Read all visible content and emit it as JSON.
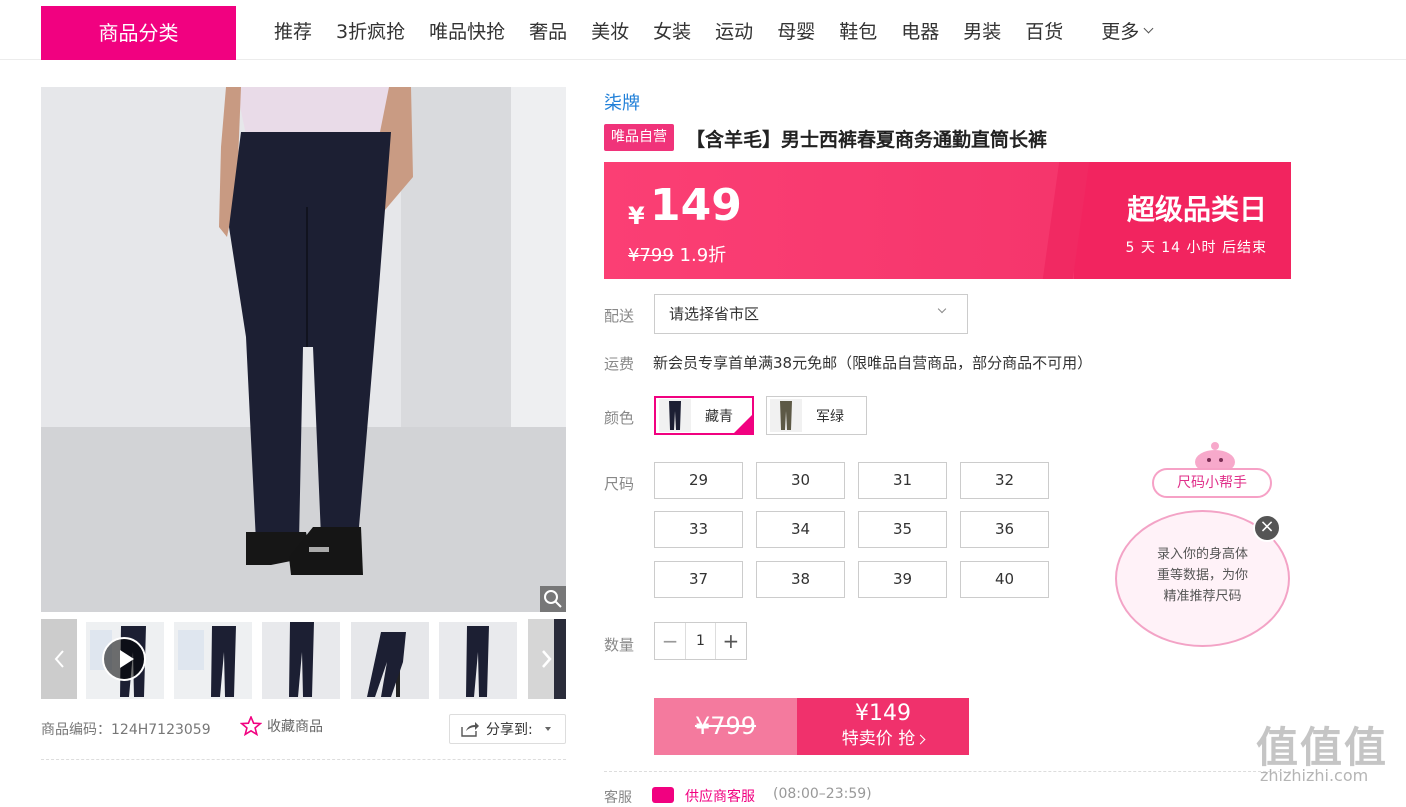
{
  "nav": {
    "category_button": "商品分类",
    "items": [
      "推荐",
      "3折疯抢",
      "唯品快抢",
      "奢品",
      "美妆",
      "女装",
      "运动",
      "母婴",
      "鞋包",
      "电器",
      "男装",
      "百货"
    ],
    "more": "更多"
  },
  "gallery": {
    "product_code_label": "商品编码：",
    "product_code": "124H7123059",
    "favorite": "收藏商品",
    "share": "分享到:"
  },
  "product": {
    "brand": "柒牌",
    "self_badge": "唯品自营",
    "title": "【含羊毛】男士西裤春夏商务通勤直筒长裤"
  },
  "price": {
    "currency": "¥",
    "current": "149",
    "original": "¥799",
    "discount": "1.9折",
    "promo_title": "超级品类日",
    "countdown": "5 天 14 小时 后结束"
  },
  "delivery": {
    "label": "配送",
    "placeholder": "请选择省市区"
  },
  "shipping": {
    "label": "运费",
    "text": "新会员专享首单满38元免邮（限唯品自营商品，部分商品不可用）"
  },
  "colors": {
    "label": "颜色",
    "options": [
      "藏青",
      "军绿"
    ],
    "selected": "藏青"
  },
  "sizes": {
    "label": "尺码",
    "options": [
      "29",
      "30",
      "31",
      "32",
      "33",
      "34",
      "35",
      "36",
      "37",
      "38",
      "39",
      "40"
    ]
  },
  "quantity": {
    "label": "数量",
    "value": "1",
    "minus": "−",
    "plus": "+"
  },
  "buy": {
    "original": "¥799",
    "price": "¥149",
    "label": "特卖价 抢"
  },
  "service": {
    "label": "客服",
    "name": "供应商客服",
    "hours": "(08:00–23:59)"
  },
  "size_helper": {
    "tag": "尺码小帮手",
    "text_line1": "录入你的身高体",
    "text_line2": "重等数据，为你",
    "text_line3": "精准推荐尺码",
    "close": "×"
  },
  "watermark": {
    "text": "值值值",
    "url": "zhizhizhi.com"
  },
  "colors_palette": {
    "accent": "#f10180",
    "price_bg": "#f23168",
    "brand_link": "#1f7fd8"
  }
}
